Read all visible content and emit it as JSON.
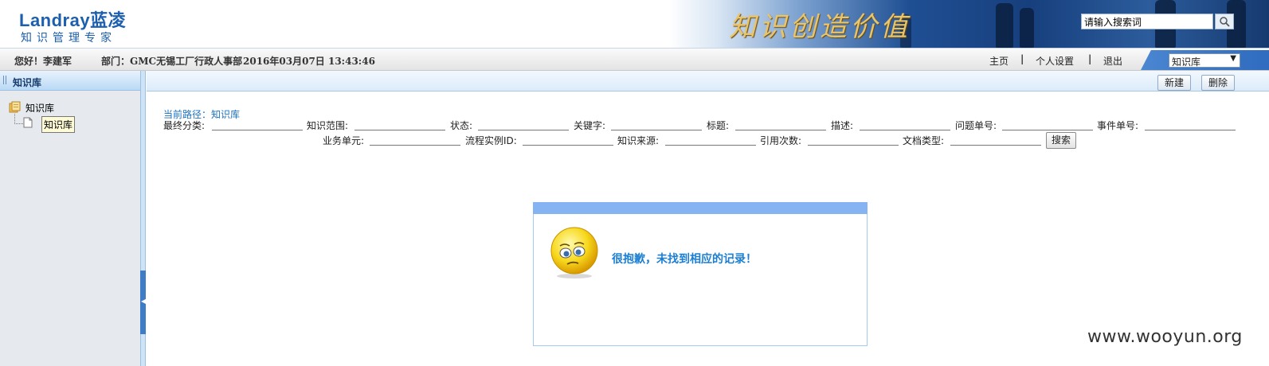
{
  "header": {
    "logo_en": "Landray蓝凌",
    "logo_sub": "知识管理专家",
    "slogan": "知识创造价值",
    "search_placeholder": "请输入搜索词",
    "search_value": "请输入搜索词"
  },
  "topbar": {
    "greeting": "您好！李建军",
    "department": "部门：GMC无锡工厂行政人事部",
    "datetime": "2016年03月07日 13:43:46",
    "nav": [
      "主页",
      "个人设置",
      "退出"
    ],
    "module_select": "知识库"
  },
  "sidebar": {
    "title": "知识库",
    "tree_root": "知识库",
    "tree_child": "知识库"
  },
  "toolbar": {
    "new_label": "新建",
    "delete_label": "删除"
  },
  "main": {
    "breadcrumb": "当前路径：知识库",
    "filters_row1": [
      "最终分类:",
      "知识范围:",
      "状态:",
      "关键字:",
      "标题:",
      "描述:",
      "问题单号:",
      "事件单号:"
    ],
    "filters_row2": [
      "业务单元:",
      "流程实例ID:",
      "知识来源:",
      "引用次数:",
      "文档类型:"
    ],
    "search_button": "搜索",
    "empty_message": "很抱歉，未找到相应的记录！"
  },
  "watermark": "www.wooyun.org",
  "colors": {
    "accent": "#1b5fae",
    "link": "#1b72c2",
    "message": "#1b7ed3",
    "bar": "#86b3f2"
  }
}
